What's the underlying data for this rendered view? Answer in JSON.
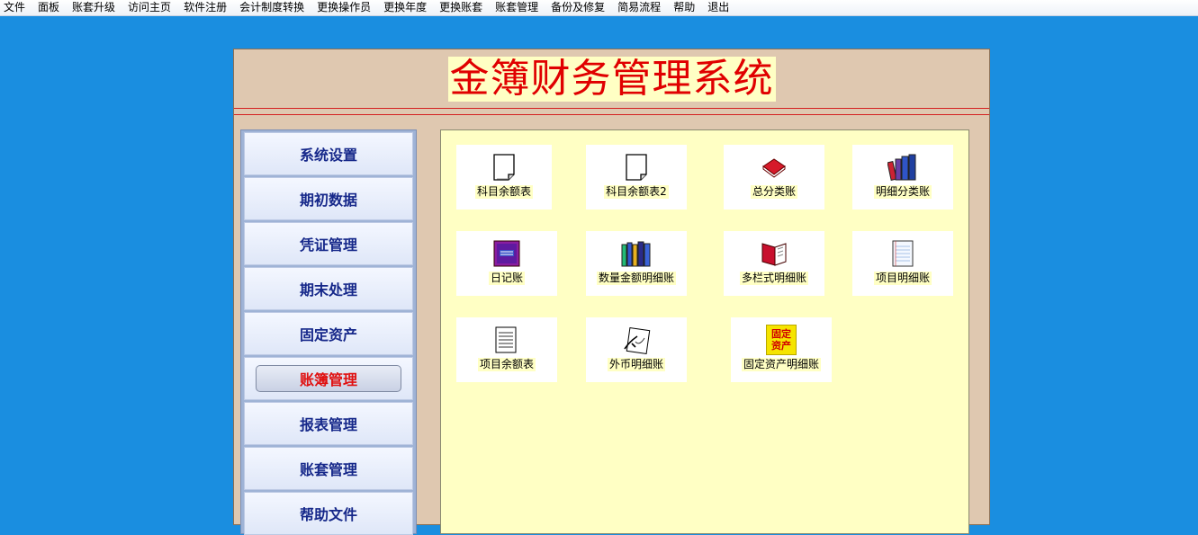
{
  "menu": [
    "文件",
    "面板",
    "账套升级",
    "访问主页",
    "软件注册",
    "会计制度转换",
    "更换操作员",
    "更换年度",
    "更换账套",
    "账套管理",
    "备份及修复",
    "简易流程",
    "帮助",
    "退出"
  ],
  "app": {
    "title": "金簿财务管理系统"
  },
  "nav": [
    "系统设置",
    "期初数据",
    "凭证管理",
    "期末处理",
    "固定资产",
    "账簿管理",
    "报表管理",
    "账套管理",
    "帮助文件"
  ],
  "active_nav": "账簿管理",
  "tiles": [
    {
      "label": "科目余额表",
      "icon": "document-icon"
    },
    {
      "label": "科目余额表2",
      "icon": "document-icon"
    },
    {
      "label": "总分类账",
      "icon": "red-book-icon"
    },
    {
      "label": "明细分类账",
      "icon": "books-icon"
    },
    {
      "label": "日记账",
      "icon": "diary-icon"
    },
    {
      "label": "数量金额明细账",
      "icon": "bookshelf-icon"
    },
    {
      "label": "多栏式明细账",
      "icon": "open-book-icon"
    },
    {
      "label": "项目明细账",
      "icon": "notepad-icon"
    },
    {
      "label": "项目余额表",
      "icon": "report-icon"
    },
    {
      "label": "外币明细账",
      "icon": "signature-icon"
    },
    {
      "label": "固定资产明细账",
      "icon": "fixed-assets-icon"
    }
  ],
  "fixed_asset_icon_text": [
    "固定",
    "资产"
  ],
  "colors": {
    "title_red": "#e00000",
    "nav_text": "#16288a",
    "active_text": "#e01010",
    "content_bg": "#ffffc4"
  }
}
